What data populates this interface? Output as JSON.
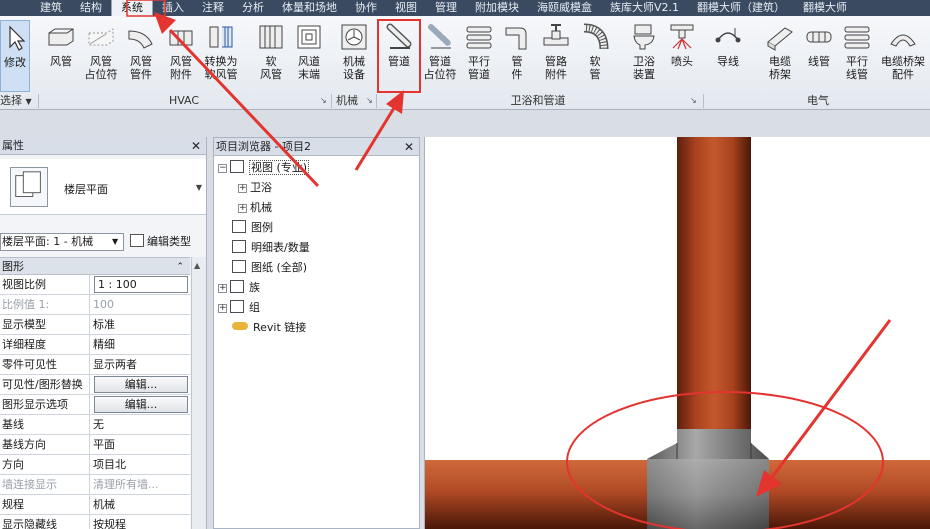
{
  "ribbon": {
    "tabs": [
      "建筑",
      "结构",
      "系统",
      "插入",
      "注释",
      "分析",
      "体量和场地",
      "协作",
      "视图",
      "管理",
      "附加模块",
      "海颐威模盒",
      "族库大师V2.1",
      "翻模大师（建筑）",
      "翻模大师"
    ],
    "active_tab": "系统",
    "buttons": {
      "modify": "修改",
      "duct": "风管",
      "duct_placeholder": "风管\n占位符",
      "duct_fitting": "风管\n管件",
      "duct_accessory": "风管\n附件",
      "convert_flex_duct": "转换为\n软风管",
      "flex_duct": "软\n风管",
      "air_terminal": "风道\n末端",
      "mech_equipment": "机械\n设备",
      "pipe": "管道",
      "pipe_placeholder": "管道\n占位符",
      "parallel_pipes": "平行\n管道",
      "pipe_fitting": "管\n件",
      "pipe_accessory": "管路\n附件",
      "flex_pipe": "软\n管",
      "plumbing_fixture": "卫浴\n装置",
      "sprinkler": "喷头",
      "wire": "导线",
      "cable_tray": "电缆\n桥架",
      "conduit": "线管",
      "parallel_conduits": "平行\n线管",
      "cable_tray_fitting": "电缆桥架\n配件"
    },
    "groups": {
      "select": "选择",
      "hvac": "HVAC",
      "mechanical": "机械",
      "plumbing": "卫浴和管道",
      "electrical": "电气"
    }
  },
  "properties": {
    "title": "属性",
    "type_name": "楼层平面",
    "view_selector": "楼层平面: 1 - 机械",
    "edit_type": "编辑类型",
    "group": "图形",
    "rows": [
      {
        "k": "视图比例",
        "v": "1 : 100"
      },
      {
        "k": "比例值 1:",
        "v": "100"
      },
      {
        "k": "显示模型",
        "v": "标准"
      },
      {
        "k": "详细程度",
        "v": "精细"
      },
      {
        "k": "零件可见性",
        "v": "显示两者"
      },
      {
        "k": "可见性/图形替换",
        "v": "编辑..."
      },
      {
        "k": "图形显示选项",
        "v": "编辑..."
      },
      {
        "k": "基线",
        "v": "无"
      },
      {
        "k": "基线方向",
        "v": "平面"
      },
      {
        "k": "方向",
        "v": "项目北"
      },
      {
        "k": "墙连接显示",
        "v": "清理所有墙..."
      },
      {
        "k": "规程",
        "v": "机械"
      },
      {
        "k": "显示隐藏线",
        "v": "按规程"
      }
    ]
  },
  "browser": {
    "title": "项目浏览器 - 项目2",
    "items": {
      "views": "视图 (专业)",
      "plumbing": "卫浴",
      "mechanical": "机械",
      "legends": "图例",
      "schedules": "明细表/数量",
      "sheets": "图纸 (全部)",
      "families": "族",
      "groups": "组",
      "revit_links": "Revit 链接"
    }
  },
  "colors": {
    "annotation_red": "#e3342f",
    "pipe_copper": "#b14a25",
    "fitting_gray": "#8c8c8c"
  }
}
